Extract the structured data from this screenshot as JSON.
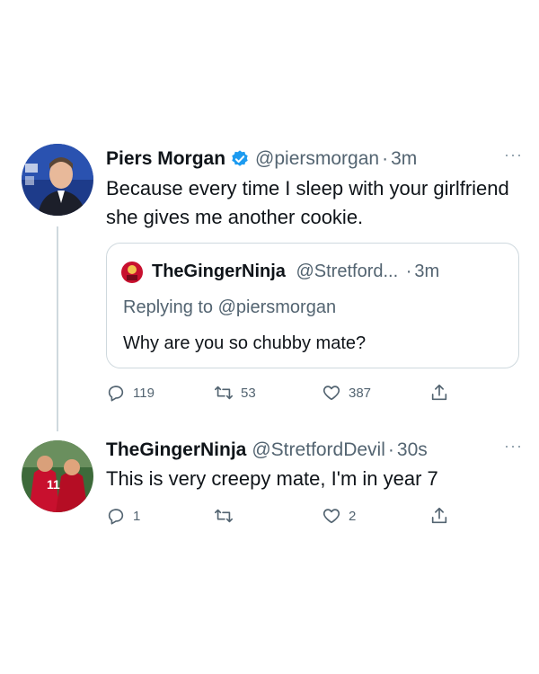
{
  "tweet1": {
    "name": "Piers Morgan",
    "handle": "@piersmorgan",
    "time": "3m",
    "text": "Because every time I sleep with your girlfriend she gives me another cookie.",
    "stats": {
      "replies": "119",
      "retweets": "53",
      "likes": "387"
    }
  },
  "quote": {
    "name": "TheGingerNinja",
    "handle": "@Stretford...",
    "time": "3m",
    "replying_to": "Replying to @piersmorgan",
    "text": "Why are you so chubby mate?"
  },
  "tweet2": {
    "name": "TheGingerNinja",
    "handle": "@StretfordDevil",
    "time": "30s",
    "text": "This is very creepy mate, I'm in year 7",
    "stats": {
      "replies": "1",
      "retweets": "",
      "likes": "2"
    }
  },
  "colors": {
    "text": "#0f1419",
    "secondary": "#536471",
    "verified": "#1d9bf0",
    "border": "#cfd9de"
  },
  "icons": [
    "verified-badge-icon",
    "more-icon",
    "reply-icon",
    "retweet-icon",
    "like-icon",
    "share-icon"
  ]
}
